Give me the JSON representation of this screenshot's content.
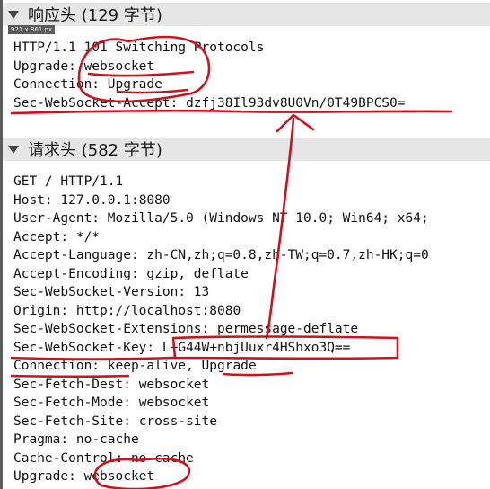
{
  "size_badge": "921 x 861  px",
  "response": {
    "title": "响应头 (129 字节)",
    "lines": [
      {
        "name": "HTTP/1.1 101 Switching Protocols",
        "value": ""
      },
      {
        "name": "Upgrade: ",
        "value": "websocket"
      },
      {
        "name": "Connection: ",
        "value": "Upgrade"
      },
      {
        "name": "Sec-WebSocket-Accept: ",
        "value": "dzfj38Il93dv8U0Vn/0T49BPCS0="
      }
    ]
  },
  "request": {
    "title": "请求头 (582 字节)",
    "lines": [
      {
        "name": "GET / HTTP/1.1",
        "value": ""
      },
      {
        "name": "Host: ",
        "value": "127.0.0.1:8080"
      },
      {
        "name": "User-Agent: ",
        "value": "Mozilla/5.0 (Windows NT 10.0; Win64; x64;"
      },
      {
        "name": "Accept: ",
        "value": "*/*"
      },
      {
        "name": "Accept-Language: ",
        "value": "zh-CN,zh;q=0.8,zh-TW;q=0.7,zh-HK;q=0"
      },
      {
        "name": "Accept-Encoding: ",
        "value": "gzip, deflate"
      },
      {
        "name": "Sec-WebSocket-Version: ",
        "value": "13"
      },
      {
        "name": "Origin: ",
        "value": "http://localhost:8080"
      },
      {
        "name": "Sec-WebSocket-Extensions: ",
        "value": "permessage-deflate"
      },
      {
        "name": "Sec-WebSocket-Key: ",
        "value": "L+G44W+nbjUuxr4HShxo3Q=="
      },
      {
        "name": "Connection: ",
        "value": "keep-alive, Upgrade"
      },
      {
        "name": "Sec-Fetch-Dest: ",
        "value": "websocket"
      },
      {
        "name": "Sec-Fetch-Mode: ",
        "value": "websocket"
      },
      {
        "name": "Sec-Fetch-Site: ",
        "value": "cross-site"
      },
      {
        "name": "Pragma: ",
        "value": "no-cache"
      },
      {
        "name": "Cache-Control: ",
        "value": "no-cache"
      },
      {
        "name": "Upgrade: ",
        "value": "websocket"
      }
    ]
  },
  "colors": {
    "annotation_red": "#d0101a",
    "header_bg": "#e6e6e6"
  }
}
